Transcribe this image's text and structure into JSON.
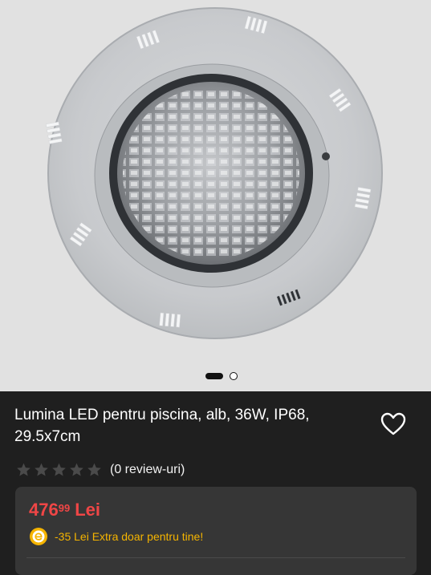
{
  "gallery": {
    "image_alt": "pool light",
    "slide_count": 2,
    "active_slide": 1
  },
  "product": {
    "title": "Lumina LED pentru piscina, alb, 36W, IP68, 29.5x7cm",
    "rating": 0,
    "rating_max": 5,
    "reviews_label": "(0 review-uri)"
  },
  "price": {
    "whole": "476",
    "cents": "99",
    "currency": "Lei"
  },
  "promo": {
    "text": "-35 Lei Extra doar pentru tine!"
  },
  "colors": {
    "price": "#f04646",
    "promo": "#f5b400",
    "background": "#1f1f1f",
    "card": "#363636"
  }
}
